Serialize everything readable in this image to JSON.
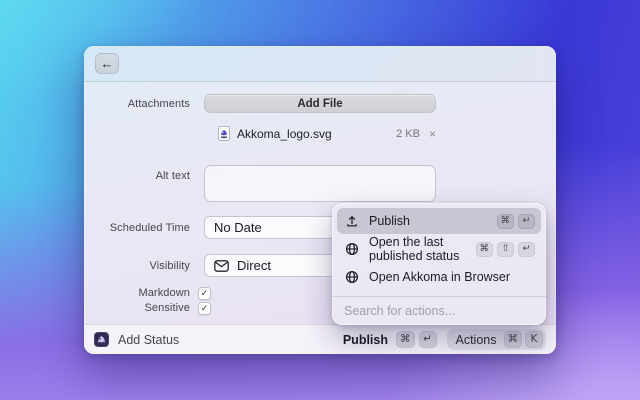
{
  "window": {
    "back_icon": "←"
  },
  "form": {
    "attachments": {
      "label": "Attachments",
      "add_file_button": "Add File",
      "file": {
        "name": "Akkoma_logo.svg",
        "size": "2 KB",
        "remove_icon": "×"
      }
    },
    "alt_text": {
      "label": "Alt text",
      "value": ""
    },
    "scheduled_time": {
      "label": "Scheduled Time",
      "value": "No Date"
    },
    "visibility": {
      "label": "Visibility",
      "value": "Direct"
    },
    "markdown": {
      "label": "Markdown",
      "checked": true,
      "check_icon": "✓"
    },
    "sensitive": {
      "label": "Sensitive",
      "checked": true,
      "check_icon": "✓"
    }
  },
  "footer": {
    "add_status_label": "Add Status",
    "publish_label": "Publish",
    "publish_keys": [
      "⌘",
      "↵"
    ],
    "actions_label": "Actions",
    "actions_keys": [
      "⌘",
      "K"
    ]
  },
  "popup": {
    "items": [
      {
        "label": "Publish",
        "icon": "upload-icon",
        "keys": [
          "⌘",
          "↵"
        ],
        "highlighted": true
      },
      {
        "label": "Open the last published status",
        "icon": "globe-icon",
        "keys": [
          "⌘",
          "⇧",
          "↵"
        ],
        "highlighted": false
      },
      {
        "label": "Open Akkoma in Browser",
        "icon": "globe-icon",
        "keys": [],
        "highlighted": false
      }
    ],
    "search_placeholder": "Search for actions..."
  },
  "colors": {
    "bg_gradient_top_left": "#57d2ef",
    "bg_gradient_top_right": "#3a38d6",
    "bg_gradient_bottom": "#aa8cf0",
    "popup_highlight": "#c8c6d2",
    "window_tint": "#e9e8f4"
  }
}
